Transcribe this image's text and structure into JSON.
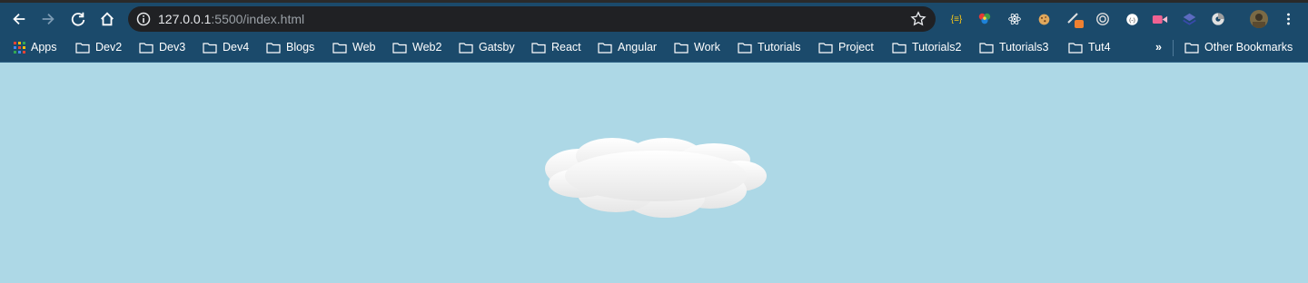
{
  "browser": {
    "url_host": "127.0.0.1",
    "url_rest": ":5500/index.html",
    "nav": {
      "back_icon": "arrow-left-icon",
      "forward_icon": "arrow-right-icon",
      "reload_icon": "reload-icon",
      "home_icon": "home-icon"
    },
    "extensions": [
      "json-viewer",
      "color-wheel",
      "react-devtools",
      "cookie",
      "pen-tool",
      "target",
      "clipboard",
      "video",
      "layers",
      "chrome-dark",
      "avatar"
    ]
  },
  "bookmarks": {
    "apps_label": "Apps",
    "folders": [
      "Dev2",
      "Dev3",
      "Dev4",
      "Blogs",
      "Web",
      "Web2",
      "Gatsby",
      "React",
      "Angular",
      "Work",
      "Tutorials",
      "Project",
      "Tutorials2",
      "Tutorials3",
      "Tut4"
    ],
    "overflow_label": "»",
    "other_label": "Other Bookmarks"
  },
  "colors": {
    "toolbar": "#1b4a6b",
    "page_background": "#add8e6",
    "omnibox": "#202124",
    "cloud_top": "#ffffff",
    "cloud_bottom": "#e6e6e6"
  }
}
